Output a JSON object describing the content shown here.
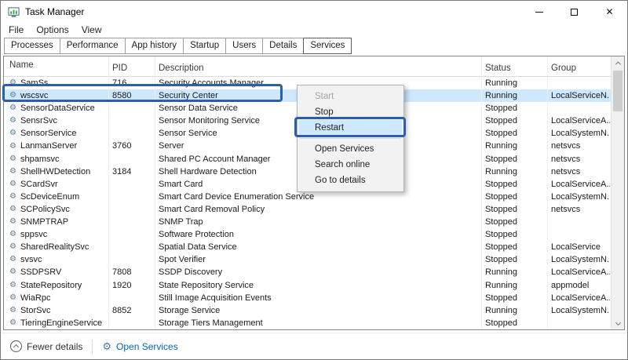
{
  "window": {
    "title": "Task Manager"
  },
  "window_controls": {
    "close_glyph": "✕"
  },
  "menu_bar": {
    "items": [
      "File",
      "Options",
      "View"
    ]
  },
  "tabs": {
    "items": [
      "Processes",
      "Performance",
      "App history",
      "Startup",
      "Users",
      "Details",
      "Services"
    ],
    "active": "Services"
  },
  "table": {
    "columns": [
      "Name",
      "PID",
      "Description",
      "Status",
      "Group"
    ],
    "sort": {
      "column": "Description",
      "direction": "ascending"
    },
    "rows": [
      {
        "name": "SamSs",
        "pid": "716",
        "description": "Security Accounts Manager",
        "status": "Running",
        "group": "",
        "selected": false
      },
      {
        "name": "wscsvc",
        "pid": "8580",
        "description": "Security Center",
        "status": "Running",
        "group": "LocalServiceN...",
        "selected": true
      },
      {
        "name": "SensorDataService",
        "pid": "",
        "description": "Sensor Data Service",
        "status": "Stopped",
        "group": "",
        "selected": false
      },
      {
        "name": "SensrSvc",
        "pid": "",
        "description": "Sensor Monitoring Service",
        "status": "Stopped",
        "group": "LocalServiceA...",
        "selected": false
      },
      {
        "name": "SensorService",
        "pid": "",
        "description": "Sensor Service",
        "status": "Stopped",
        "group": "LocalSystemN...",
        "selected": false
      },
      {
        "name": "LanmanServer",
        "pid": "3760",
        "description": "Server",
        "status": "Running",
        "group": "netsvcs",
        "selected": false
      },
      {
        "name": "shpamsvc",
        "pid": "",
        "description": "Shared PC Account Manager",
        "status": "Stopped",
        "group": "netsvcs",
        "selected": false
      },
      {
        "name": "ShellHWDetection",
        "pid": "3184",
        "description": "Shell Hardware Detection",
        "status": "Running",
        "group": "netsvcs",
        "selected": false
      },
      {
        "name": "SCardSvr",
        "pid": "",
        "description": "Smart Card",
        "status": "Stopped",
        "group": "LocalServiceA...",
        "selected": false
      },
      {
        "name": "ScDeviceEnum",
        "pid": "",
        "description": "Smart Card Device Enumeration Service",
        "status": "Stopped",
        "group": "LocalSystemN...",
        "selected": false
      },
      {
        "name": "SCPolicySvc",
        "pid": "",
        "description": "Smart Card Removal Policy",
        "status": "Stopped",
        "group": "netsvcs",
        "selected": false
      },
      {
        "name": "SNMPTRAP",
        "pid": "",
        "description": "SNMP Trap",
        "status": "Stopped",
        "group": "",
        "selected": false
      },
      {
        "name": "sppsvc",
        "pid": "",
        "description": "Software Protection",
        "status": "Stopped",
        "group": "",
        "selected": false
      },
      {
        "name": "SharedRealitySvc",
        "pid": "",
        "description": "Spatial Data Service",
        "status": "Stopped",
        "group": "LocalService",
        "selected": false
      },
      {
        "name": "svsvc",
        "pid": "",
        "description": "Spot Verifier",
        "status": "Stopped",
        "group": "LocalSystemN...",
        "selected": false
      },
      {
        "name": "SSDPSRV",
        "pid": "7808",
        "description": "SSDP Discovery",
        "status": "Running",
        "group": "LocalServiceA...",
        "selected": false
      },
      {
        "name": "StateRepository",
        "pid": "1920",
        "description": "State Repository Service",
        "status": "Running",
        "group": "appmodel",
        "selected": false
      },
      {
        "name": "WiaRpc",
        "pid": "",
        "description": "Still Image Acquisition Events",
        "status": "Stopped",
        "group": "LocalServiceA...",
        "selected": false
      },
      {
        "name": "StorSvc",
        "pid": "8852",
        "description": "Storage Service",
        "status": "Running",
        "group": "LocalSystemN...",
        "selected": false
      },
      {
        "name": "TieringEngineService",
        "pid": "",
        "description": "Storage Tiers Management",
        "status": "Stopped",
        "group": "",
        "selected": false
      }
    ]
  },
  "context_menu": {
    "items": [
      {
        "label": "Start",
        "disabled": true
      },
      {
        "label": "Stop"
      },
      {
        "label": "Restart",
        "highlighted": true
      },
      {
        "separator": true
      },
      {
        "label": "Open Services"
      },
      {
        "label": "Search online"
      },
      {
        "label": "Go to details"
      }
    ]
  },
  "status_bar": {
    "fewer_details": "Fewer details",
    "open_services": "Open Services"
  },
  "icons": {
    "service_gear": "⚙",
    "open_services_gear": "⚙"
  },
  "colors": {
    "selection": "#cde8ff",
    "annotation": "#2b5fad",
    "link": "#0067b8"
  }
}
